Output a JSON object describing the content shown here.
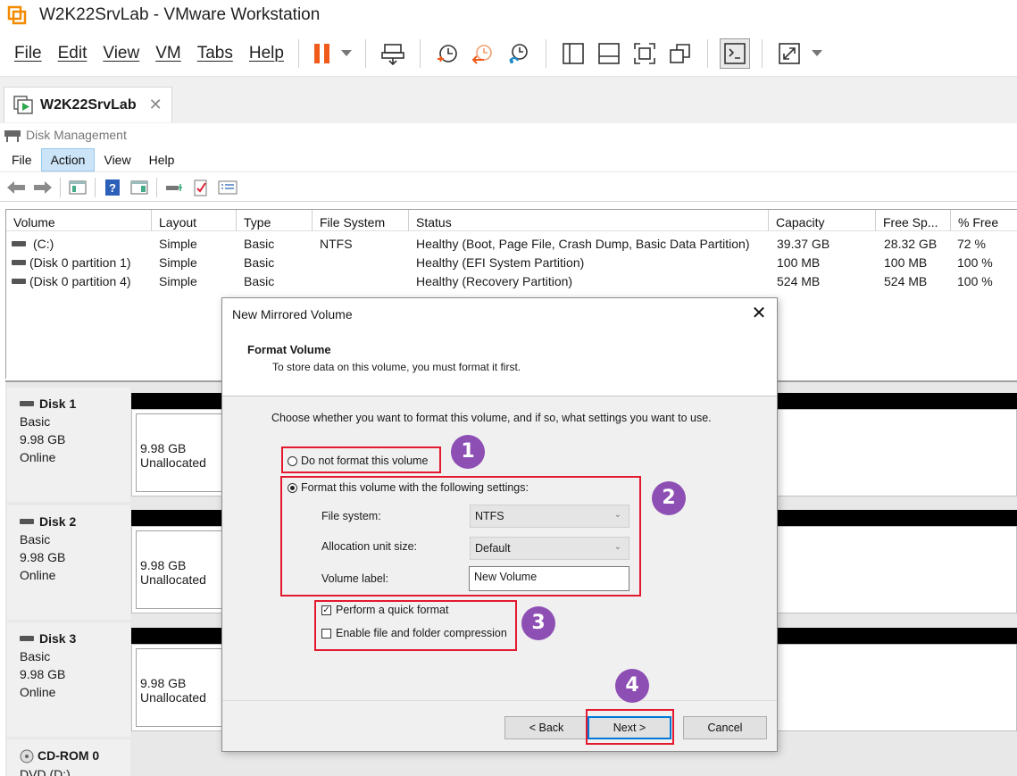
{
  "window": {
    "title": "W2K22SrvLab - VMware Workstation"
  },
  "vm_menu": [
    "File",
    "Edit",
    "View",
    "VM",
    "Tabs",
    "Help"
  ],
  "vm_toolbar_icons": [
    "pause-icon",
    "dropdown-arrow-icon",
    "send-ctrl-alt-del-icon",
    "snapshot-icon",
    "revert-snapshot-icon",
    "snapshot-manager-icon",
    "console-view-icon",
    "thumbnail-view-icon",
    "fullscreen-icon",
    "unity-icon",
    "terminal-icon",
    "stretch-icon",
    "dropdown-arrow-icon"
  ],
  "tab": {
    "label": "W2K22SrvLab",
    "close": "✕"
  },
  "disk_management": {
    "title": "Disk Management",
    "menu": [
      "File",
      "Action",
      "View",
      "Help"
    ],
    "selected_menu": "Action",
    "columns": [
      "Volume",
      "Layout",
      "Type",
      "File System",
      "Status",
      "Capacity",
      "Free Sp...",
      "% Free"
    ],
    "volumes": [
      {
        "volume": "(C:)",
        "layout": "Simple",
        "type": "Basic",
        "fs": "NTFS",
        "status": "Healthy (Boot, Page File, Crash Dump, Basic Data Partition)",
        "capacity": "39.37 GB",
        "free": "28.32 GB",
        "pct": "72 %"
      },
      {
        "volume": "(Disk 0 partition 1)",
        "layout": "Simple",
        "type": "Basic",
        "fs": "",
        "status": "Healthy (EFI System Partition)",
        "capacity": "100 MB",
        "free": "100 MB",
        "pct": "100 %"
      },
      {
        "volume": "(Disk 0 partition 4)",
        "layout": "Simple",
        "type": "Basic",
        "fs": "",
        "status": "Healthy (Recovery Partition)",
        "capacity": "524 MB",
        "free": "524 MB",
        "pct": "100 %"
      }
    ],
    "disks": [
      {
        "name": "Disk 1",
        "type": "Basic",
        "size": "9.98 GB",
        "state": "Online",
        "part_size": "9.98 GB",
        "part_state": "Unallocated"
      },
      {
        "name": "Disk 2",
        "type": "Basic",
        "size": "9.98 GB",
        "state": "Online",
        "part_size": "9.98 GB",
        "part_state": "Unallocated"
      },
      {
        "name": "Disk 3",
        "type": "Basic",
        "size": "9.98 GB",
        "state": "Online",
        "part_size": "9.98 GB",
        "part_state": "Unallocated"
      },
      {
        "name": "CD-ROM 0",
        "type": "DVD (D:)"
      }
    ]
  },
  "dialog": {
    "title": "New Mirrored Volume",
    "close": "✕",
    "heading": "Format Volume",
    "subheading": "To store data on this volume, you must format it first.",
    "intro": "Choose whether you want to format this volume, and if so, what settings you want to use.",
    "option_no_format": "Do not format this volume",
    "option_format": "Format this volume with the following settings:",
    "selected_option": "format",
    "file_system_label": "File system:",
    "file_system_value": "NTFS",
    "alloc_label": "Allocation unit size:",
    "alloc_value": "Default",
    "volume_label_label": "Volume label:",
    "volume_label_value": "New Volume",
    "quick_format_label": "Perform a quick format",
    "quick_format_checked": true,
    "compression_label": "Enable file and folder compression",
    "compression_checked": false,
    "back_button": "< Back",
    "next_button": "Next >",
    "cancel_button": "Cancel"
  },
  "annotations": {
    "badges": [
      "1",
      "2",
      "3",
      "4"
    ],
    "box_color": "#e3192f",
    "badge_color": "#8e4fb4"
  }
}
